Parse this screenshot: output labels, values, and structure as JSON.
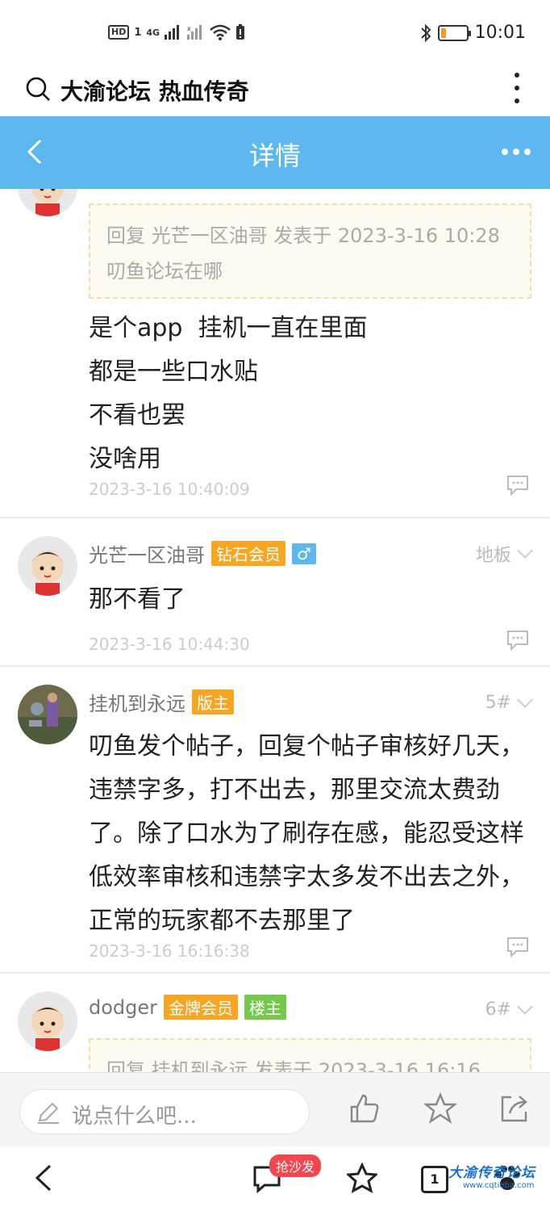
{
  "status_bar": {
    "hd": "HD",
    "sim": "1",
    "network": "4G",
    "time": "10:01",
    "battery_level": 0.18
  },
  "browser": {
    "search_text": "大渝论坛 热血传奇"
  },
  "header": {
    "title": "详情"
  },
  "posts": [
    {
      "quote_line1": "回复 光芒一区油哥 发表于 2023-3-16 10:28",
      "quote_line2": "叨鱼论坛在哪",
      "body": "是个app  挂机一直在里面\n都是一些口水贴\n不看也罢\n没啥用",
      "time": "2023-3-16 10:40:09"
    },
    {
      "user": "光芒一区油哥",
      "badge": "钻石会员",
      "gender": "♂",
      "floor": "地板",
      "body": "那不看了",
      "time": "2023-3-16 10:44:30"
    },
    {
      "user": "挂机到永远",
      "badge": "版主",
      "floor": "5#",
      "body": "叨鱼发个帖子，回复个帖子审核好几天，违禁字多，打不出去，那里交流太费劲了。除了口水为了刷存在感，能忍受这样低效率审核和违禁字太多发不出去之外，正常的玩家都不去那里了",
      "time": "2023-3-16 16:16:38"
    },
    {
      "user": "dodger",
      "badge": "金牌会员",
      "badge2": "楼主",
      "floor": "6#",
      "quote_line1": "回复 挂机到永远 发表于 2023-3-16 16:16"
    }
  ],
  "reply_bar": {
    "placeholder": "说点什么吧..."
  },
  "nav": {
    "sofa_badge": "抢沙发",
    "tab_count": "1"
  },
  "watermark": {
    "main": "大渝传奇论坛",
    "sub": "www.cqtieba.com"
  },
  "colors": {
    "header_bg": "#5cb8ee",
    "badge_orange": "#f6a623",
    "badge_green": "#74c84a",
    "sofa_red": "#f2474e"
  }
}
